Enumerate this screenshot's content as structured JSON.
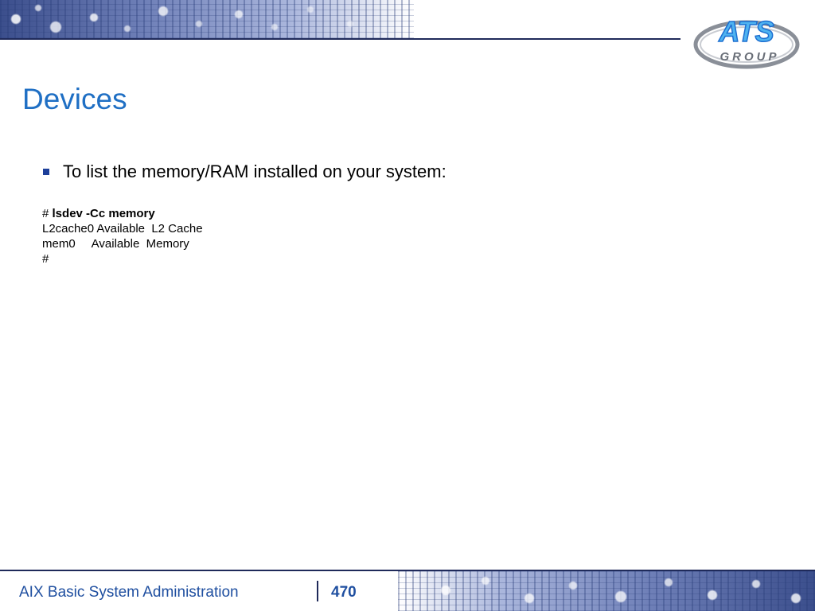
{
  "slide": {
    "title": "Devices",
    "bullet": "To list the memory/RAM installed on your system:",
    "code": {
      "prompt": "#",
      "command": "lsdev -Cc memory",
      "output_lines": [
        "L2cache0 Available  L2 Cache",
        "mem0     Available  Memory"
      ],
      "end_prompt": "#"
    }
  },
  "logo": {
    "text_main": "ATS",
    "text_sub": "GROUP",
    "colors": {
      "blue": "#1d6fd1",
      "light_blue": "#4fb3f0",
      "gray": "#8a8f98"
    }
  },
  "footer": {
    "course_title": "AIX  Basic System Administration",
    "page_number": "470"
  },
  "colors": {
    "title": "#1f6fc4",
    "footer_text": "#1f4fa0",
    "bullet_marker": "#1d3f9a",
    "rule": "#1f2a5a"
  }
}
